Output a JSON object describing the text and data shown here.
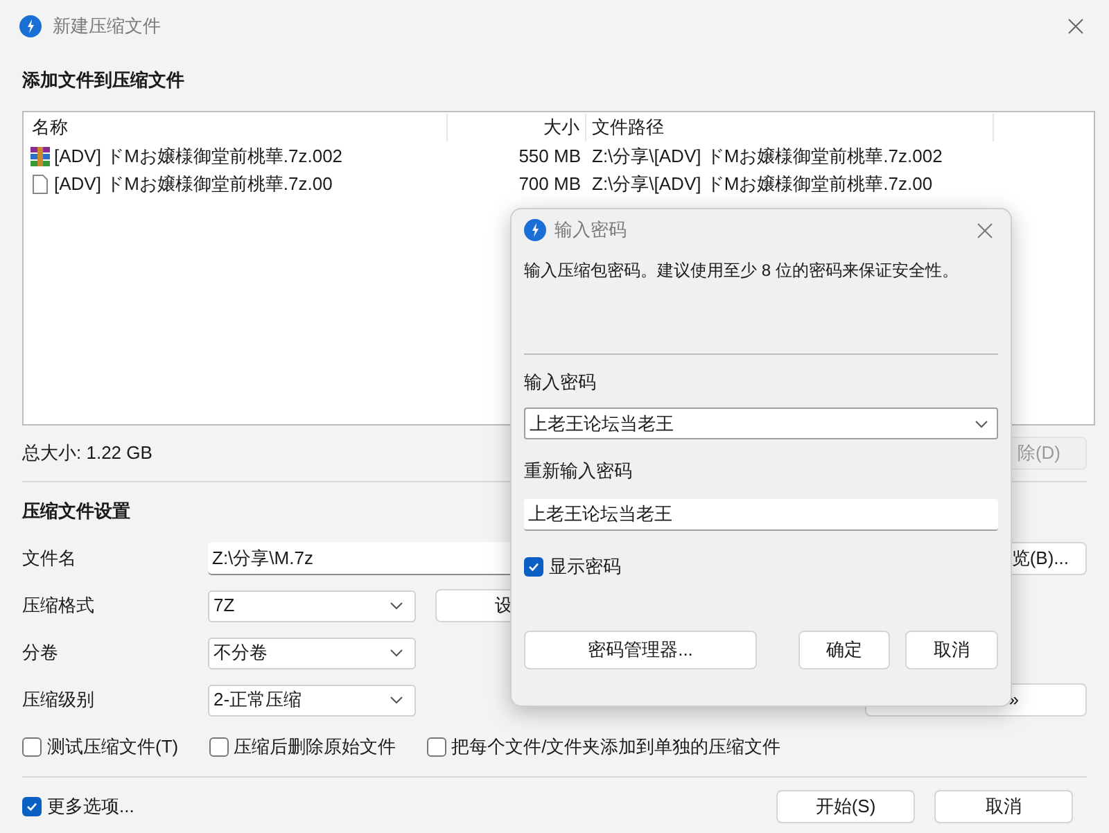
{
  "window": {
    "title": "新建压缩文件"
  },
  "section_title": "添加文件到压缩文件",
  "file_list": {
    "columns": [
      "名称",
      "大小",
      "文件路径"
    ],
    "rows": [
      {
        "kind": "archive",
        "name": "[ADV] ドMお嬢様御堂前桃華.7z.002",
        "size": "550 MB",
        "path": "Z:\\分享\\[ADV] ドMお嬢様御堂前桃華.7z.002"
      },
      {
        "kind": "file",
        "name": "[ADV] ドMお嬢様御堂前桃華.7z.00",
        "size": "700 MB",
        "path": "Z:\\分享\\[ADV] ドMお嬢様御堂前桃華.7z.00"
      }
    ]
  },
  "total_size": "总大小: 1.22 GB",
  "delete_button": "除(D)",
  "settings": {
    "title": "压缩文件设置",
    "filename": {
      "label": "文件名",
      "value": "Z:\\分享\\M.7z"
    },
    "browse_button": "览(B)...",
    "format": {
      "label": "压缩格式",
      "value": "7Z"
    },
    "format_settings_button": "设",
    "split": {
      "label": "分卷",
      "value": "不分卷"
    },
    "level": {
      "label": "压缩级别",
      "value": "2-正常压缩"
    },
    "advanced_button": "»"
  },
  "options": [
    {
      "label": "测试压缩文件(T)",
      "checked": false
    },
    {
      "label": "压缩后删除原始文件",
      "checked": false
    },
    {
      "label": "把每个文件/文件夹添加到单独的压缩文件",
      "checked": false
    }
  ],
  "more_options": {
    "label": "更多选项...",
    "checked": true
  },
  "buttons": [
    "开始(S)",
    "取消"
  ],
  "password_dialog": {
    "title": "输入密码",
    "description": "输入压缩包密码。建议使用至少 8 位的密码来保证安全性。",
    "password": {
      "label": "输入密码",
      "value": "上老王论坛当老王"
    },
    "confirm": {
      "label": "重新输入密码",
      "value": "上老王论坛当老王"
    },
    "show_password": {
      "label": "显示密码",
      "checked": true
    },
    "buttons": [
      "密码管理器...",
      "确定",
      "取消"
    ]
  }
}
